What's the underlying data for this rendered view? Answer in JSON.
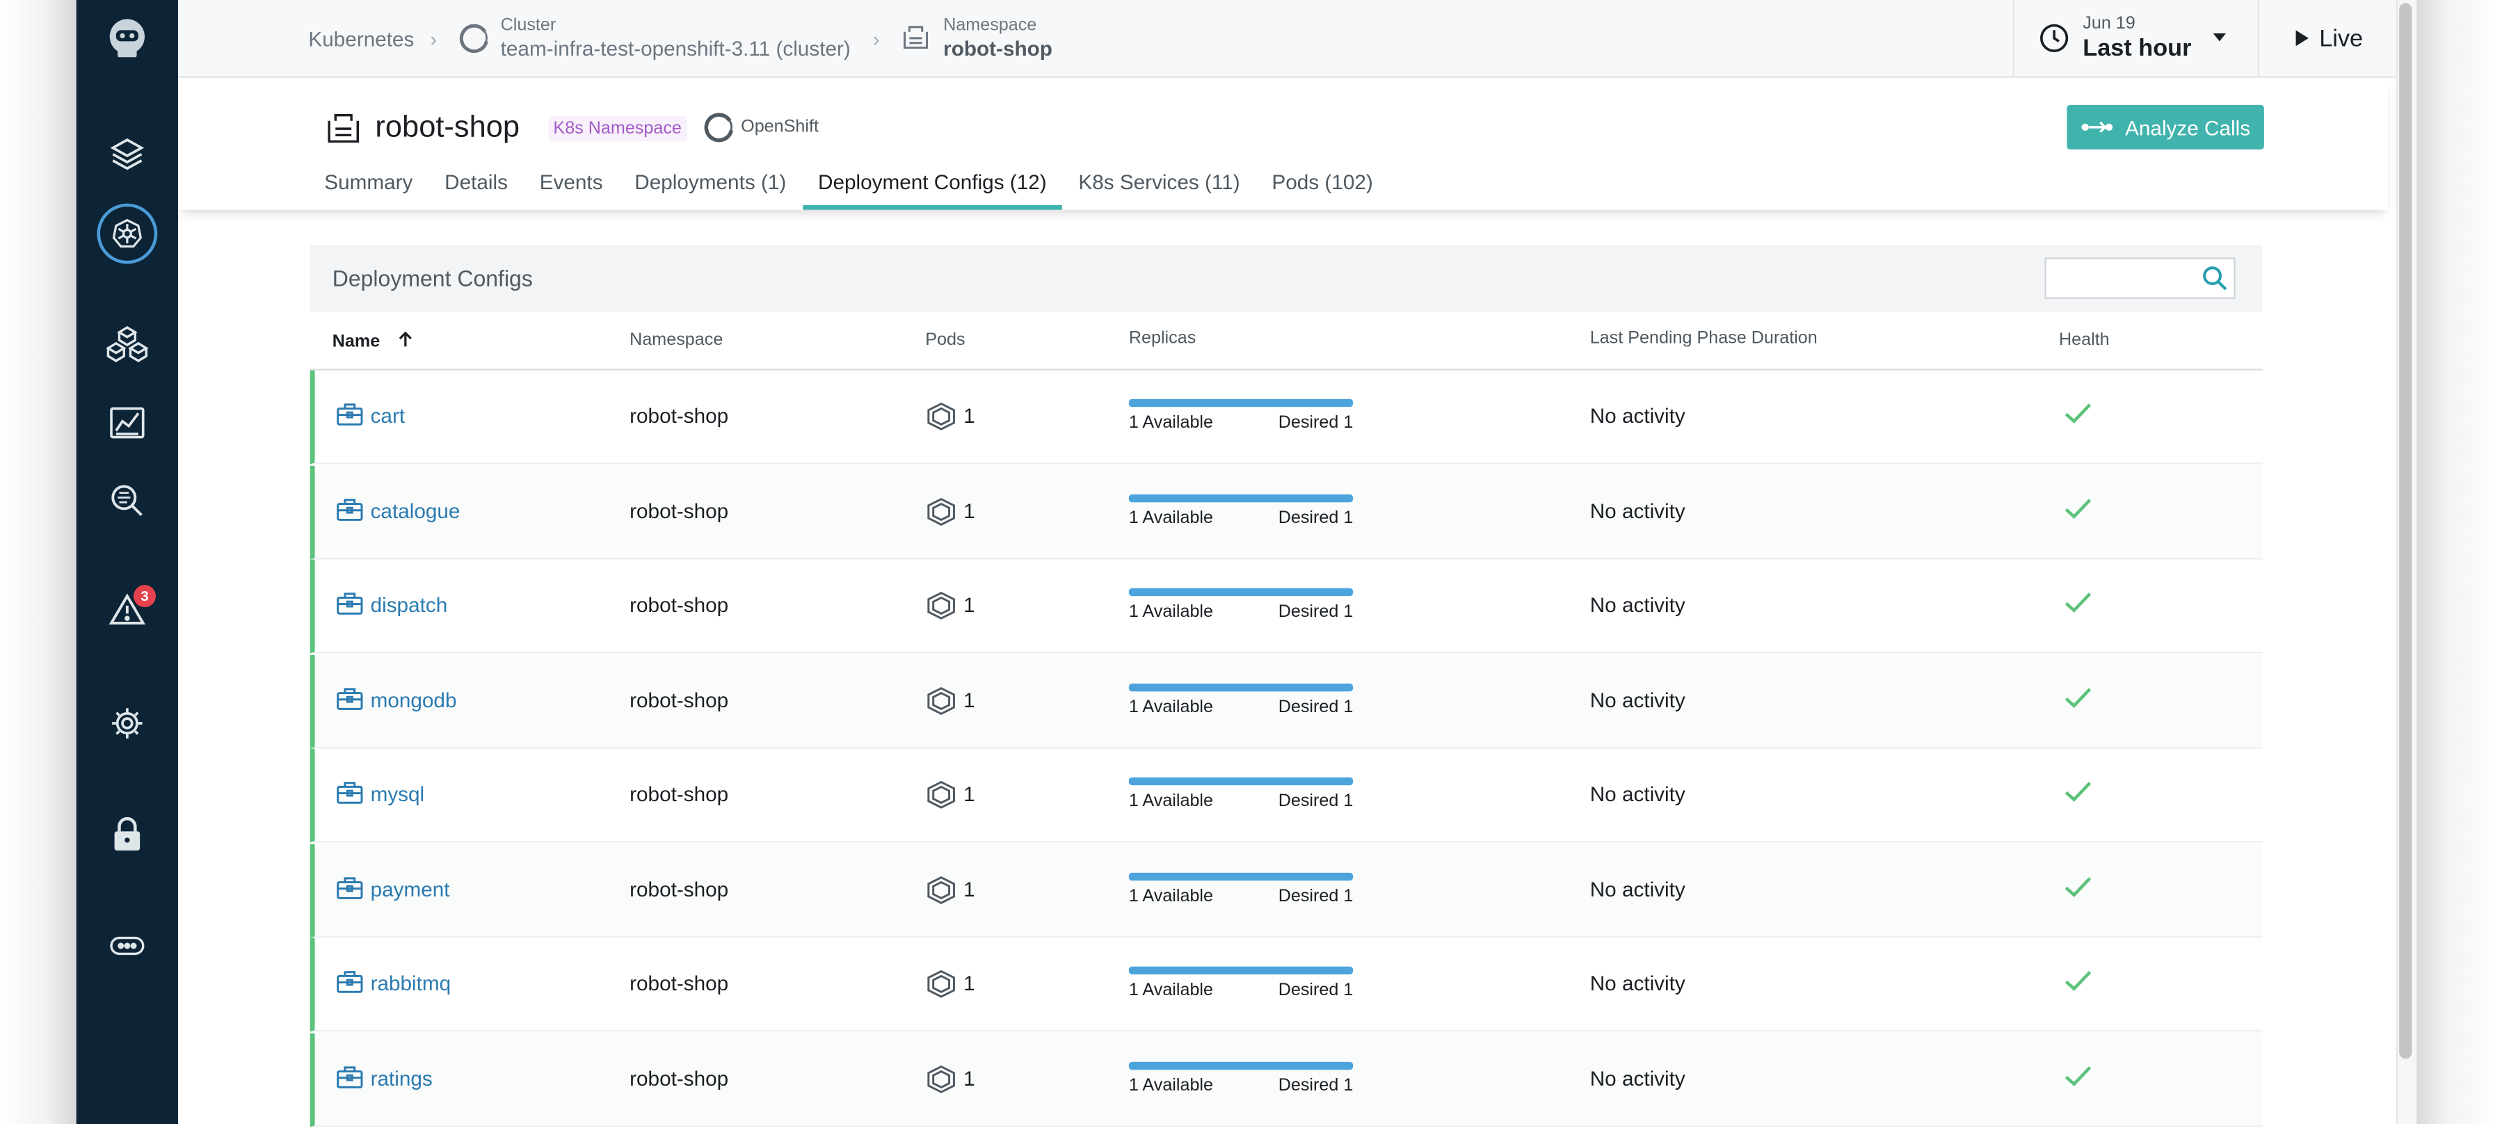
{
  "breadcrumb": {
    "root": "Kubernetes",
    "cluster_label": "Cluster",
    "cluster_value": "team-infra-test-openshift-3.11 (cluster)",
    "namespace_label": "Namespace",
    "namespace_value": "robot-shop"
  },
  "time_picker": {
    "date": "Jun 19",
    "range": "Last hour"
  },
  "live_label": "Live",
  "sidebar": {
    "alerts_badge": "3"
  },
  "header": {
    "title": "robot-shop",
    "type_badge": "K8s Namespace",
    "platform": "OpenShift",
    "analyze_label": "Analyze Calls"
  },
  "tabs": [
    {
      "label": "Summary",
      "active": false
    },
    {
      "label": "Details",
      "active": false
    },
    {
      "label": "Events",
      "active": false
    },
    {
      "label": "Deployments (1)",
      "active": false
    },
    {
      "label": "Deployment Configs (12)",
      "active": true
    },
    {
      "label": "K8s Services (11)",
      "active": false
    },
    {
      "label": "Pods (102)",
      "active": false
    }
  ],
  "table": {
    "title": "Deployment Configs",
    "search_placeholder": "",
    "columns": {
      "name": "Name",
      "namespace": "Namespace",
      "pods": "Pods",
      "replicas": "Replicas",
      "pending": "Last Pending Phase Duration",
      "health": "Health"
    },
    "rows": [
      {
        "name": "cart",
        "namespace": "robot-shop",
        "pods": "1",
        "available": "1 Available",
        "desired": "Desired 1",
        "replica_fill": 1.0,
        "pending": "No activity",
        "health": "ok"
      },
      {
        "name": "catalogue",
        "namespace": "robot-shop",
        "pods": "1",
        "available": "1 Available",
        "desired": "Desired 1",
        "replica_fill": 1.0,
        "pending": "No activity",
        "health": "ok"
      },
      {
        "name": "dispatch",
        "namespace": "robot-shop",
        "pods": "1",
        "available": "1 Available",
        "desired": "Desired 1",
        "replica_fill": 1.0,
        "pending": "No activity",
        "health": "ok"
      },
      {
        "name": "mongodb",
        "namespace": "robot-shop",
        "pods": "1",
        "available": "1 Available",
        "desired": "Desired 1",
        "replica_fill": 1.0,
        "pending": "No activity",
        "health": "ok"
      },
      {
        "name": "mysql",
        "namespace": "robot-shop",
        "pods": "1",
        "available": "1 Available",
        "desired": "Desired 1",
        "replica_fill": 1.0,
        "pending": "No activity",
        "health": "ok"
      },
      {
        "name": "payment",
        "namespace": "robot-shop",
        "pods": "1",
        "available": "1 Available",
        "desired": "Desired 1",
        "replica_fill": 1.0,
        "pending": "No activity",
        "health": "ok"
      },
      {
        "name": "rabbitmq",
        "namespace": "robot-shop",
        "pods": "1",
        "available": "1 Available",
        "desired": "Desired 1",
        "replica_fill": 1.0,
        "pending": "No activity",
        "health": "ok"
      },
      {
        "name": "ratings",
        "namespace": "robot-shop",
        "pods": "1",
        "available": "1 Available",
        "desired": "Desired 1",
        "replica_fill": 1.0,
        "pending": "No activity",
        "health": "ok"
      }
    ]
  },
  "colors": {
    "sidebar_bg": "#0d2436",
    "accent_teal": "#40b3ad",
    "link_blue": "#2a7ab0",
    "health_green": "#5cc27b",
    "replica_blue": "#4da4dd",
    "badge_purple": "#a45bc7"
  }
}
